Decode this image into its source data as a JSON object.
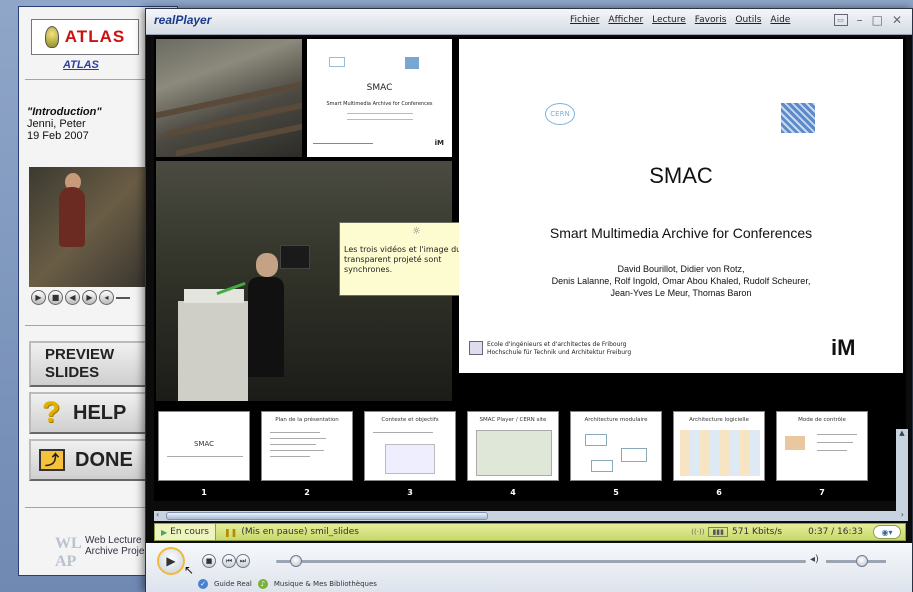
{
  "weblecture": {
    "logo_text": "ATLAS",
    "link_text": "ATLAS",
    "talk_title": "\"Introduction\"",
    "author": "Jenni, Peter",
    "date": "19 Feb 2007",
    "preview_label_1": "PREVIEW",
    "preview_label_2": "SLIDES",
    "help_label": "HELP",
    "done_label": "DONE",
    "footer_line1": "Web Lecture",
    "footer_line2": "Archive Project",
    "footer_mark": "WL AP"
  },
  "player": {
    "brand": "realPlayer",
    "menus": [
      "Fichier",
      "Afficher",
      "Lecture",
      "Favoris",
      "Outils",
      "Aide"
    ],
    "tooltip": "Les trois vidéos et l'image du transparent projeté sont synchrones.",
    "slide_main": {
      "title": "SMAC",
      "subtitle": "Smart Multimedia Archive for Conferences",
      "authors": [
        "David Bourillot, Didier von Rotz,",
        "Denis Lalanne, Rolf Ingold, Omar Abou Khaled, Rudolf Scheurer,",
        "Jean-Yves Le Meur, Thomas Baron"
      ],
      "logo_left": "CERN",
      "footer_fr": "Ecole d'ingénieurs et d'architectes de Fribourg",
      "footer_de": "Hochschule für Technik und Architektur Freiburg",
      "brand_right": "iM"
    },
    "slide_small": {
      "title": "SMAC",
      "subtitle": "Smart Multimedia Archive for Conferences"
    },
    "thumbnails": [
      {
        "num": "1",
        "title": "SMAC"
      },
      {
        "num": "2",
        "title": "Plan de la présentation"
      },
      {
        "num": "3",
        "title": "Contexte et objectifs"
      },
      {
        "num": "4",
        "title": "SMAC Player / CERN site"
      },
      {
        "num": "5",
        "title": "Architecture modulaire"
      },
      {
        "num": "6",
        "title": "Architecture logicielle"
      },
      {
        "num": "7",
        "title": "Mode de contrôle"
      }
    ],
    "status": {
      "tab": "En cours",
      "clip": "(Mis en pause) smil_slides",
      "bitrate": "571 Kbits/s",
      "time": "0:37 / 16:33"
    },
    "bottom_links": {
      "guide": "Guide Real",
      "music": "Musique & Mes Bibliothèques"
    },
    "seek_fraction": 0.037,
    "volume_fraction": 0.6,
    "accent_color": "#f2b93b"
  }
}
